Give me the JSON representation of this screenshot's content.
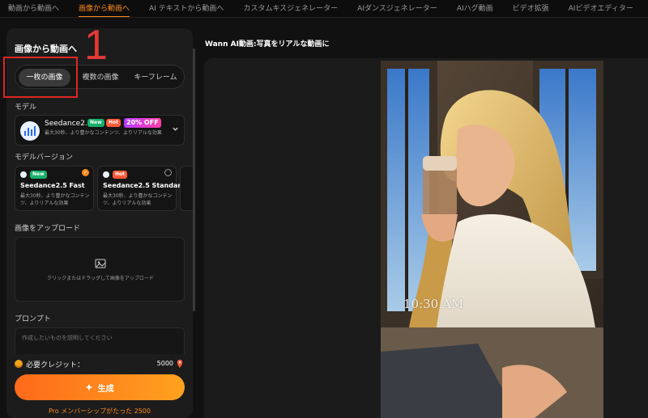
{
  "nav": {
    "tabs": [
      "動画から動画へ",
      "画像から動画へ",
      "AI テキストから動画へ",
      "カスタムキスジェネレーター",
      "AIダンスジェネレーター",
      "AIハグ動画",
      "ビデオ拡張",
      "AIビデオエディター"
    ],
    "active_index": 1
  },
  "left": {
    "title": "画像から動画へ",
    "annotation_number": "1",
    "mode_tabs": [
      "一枚の画像",
      "複数の画像",
      "キーフレーム"
    ],
    "model_label": "モデル",
    "model": {
      "name": "Seedance2.5",
      "badge_new": "New",
      "badge_hot": "Hot",
      "badge_off": "20% OFF",
      "desc": "最大30秒、より豊かなコンテンツ、よりリアルな効果"
    },
    "version_label": "モデルバージョン",
    "versions": [
      {
        "name": "Seedance2.5 Fast",
        "badge": "New",
        "desc": "最大30秒、より豊かなコンテンツ、よりリアルな効果",
        "selected": true
      },
      {
        "name": "Seedance2.5 Standard",
        "badge": "Hot",
        "desc": "最大30秒、より豊かなコンテンツ、よりリアルな効果",
        "selected": false
      }
    ],
    "upload_label": "画像をアップロード",
    "upload_hint": "クリックまたはドラッグして画像をアップロード",
    "prompt_label": "プロンプト",
    "prompt_placeholder": "作成したいものを説明してください",
    "credits_label": "必要クレジット：",
    "credits_value": "5000",
    "generate_label": "生成",
    "member_note": "Pro メンバーシップがたった 2500"
  },
  "right": {
    "title": "Wann AI動画:写真をリアルな動画に",
    "photo_caption": "10:30 AM"
  },
  "colors": {
    "accent": "#ff8a1f",
    "annotation": "#e53935",
    "panel": "#1c1c1c"
  }
}
